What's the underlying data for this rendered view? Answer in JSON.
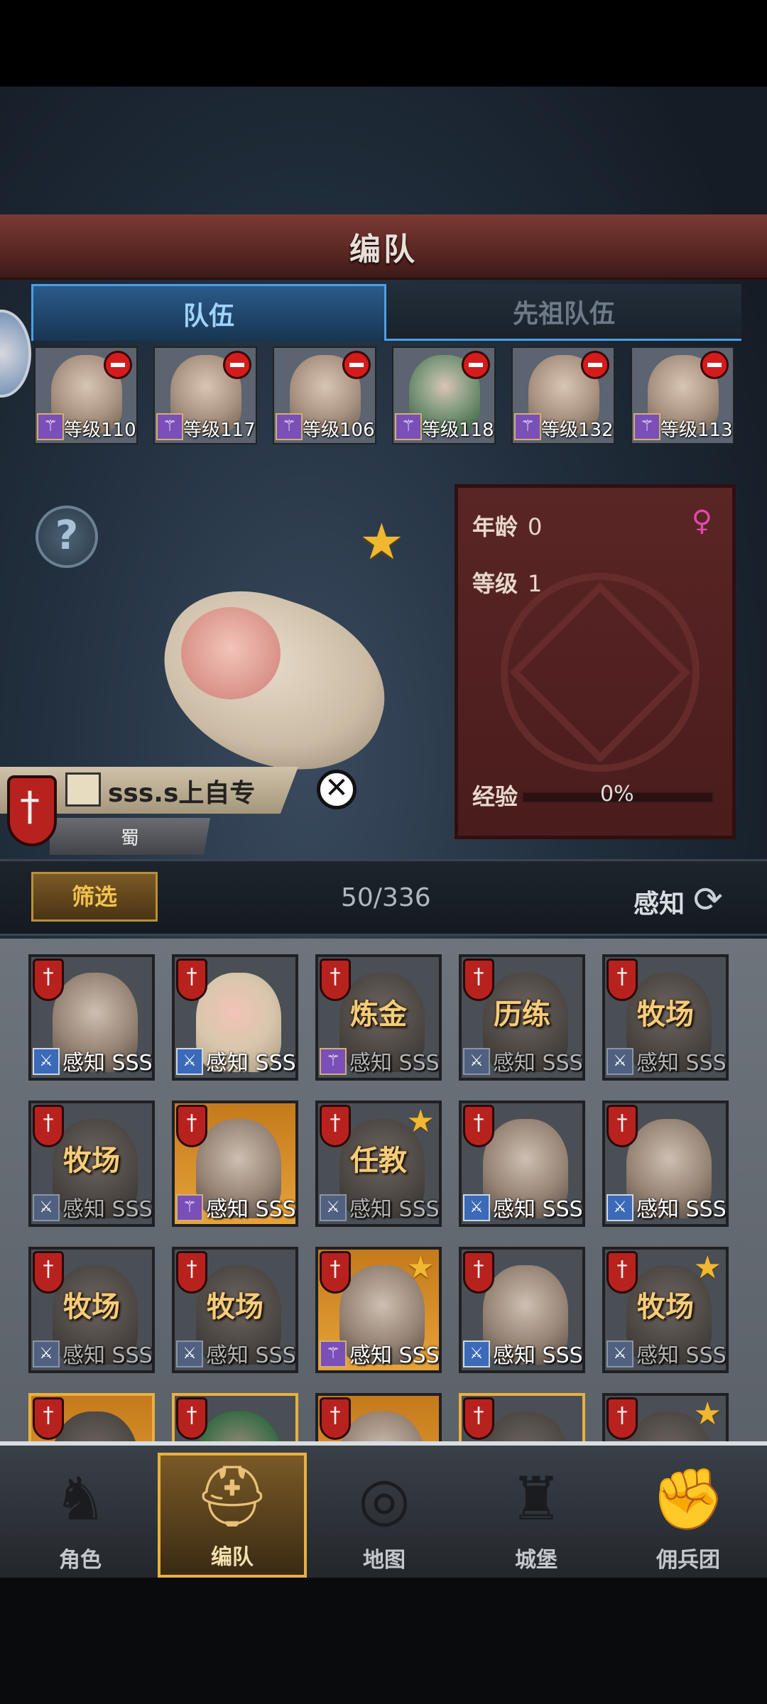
{
  "title": "编队",
  "tabs": {
    "team": "队伍",
    "ancestor_team": "先祖队伍"
  },
  "team_members": [
    {
      "level_text": "等级110"
    },
    {
      "level_text": "等级117"
    },
    {
      "level_text": "等级106"
    },
    {
      "level_text": "等级118"
    },
    {
      "level_text": "等级132"
    },
    {
      "level_text": "等级113"
    }
  ],
  "info": {
    "age_label": "年龄",
    "age_value": "0",
    "level_label": "等级",
    "level_value": "1",
    "exp_label": "经验",
    "exp_value": "0%",
    "exp_progress": 0
  },
  "character": {
    "name": "sss.s上自专",
    "faction": "蜀"
  },
  "filter": {
    "button": "筛选",
    "count": "50/336",
    "sort_label": "感知"
  },
  "grid": {
    "cards": [
      {
        "job": "",
        "stat": "感知 SSS"
      },
      {
        "job": "",
        "stat": "感知 SSS"
      },
      {
        "job": "炼金",
        "stat": "感知 SSS"
      },
      {
        "job": "历练",
        "stat": "感知 SSS"
      },
      {
        "job": "牧场",
        "stat": "感知 SSS"
      },
      {
        "job": "牧场",
        "stat": "感知 SSS"
      },
      {
        "job": "",
        "stat": "感知 SSS"
      },
      {
        "job": "任教",
        "stat": "感知 SSS"
      },
      {
        "job": "",
        "stat": "感知 SSS"
      },
      {
        "job": "",
        "stat": "感知 SSS"
      },
      {
        "job": "牧场",
        "stat": "感知 SSS"
      },
      {
        "job": "牧场",
        "stat": "感知 SSS"
      },
      {
        "job": "",
        "stat": "感知 SSS"
      },
      {
        "job": "",
        "stat": "感知 SSS"
      },
      {
        "job": "牧场",
        "stat": "感知 SSS"
      }
    ]
  },
  "nav": {
    "character": "角色",
    "formation": "编队",
    "map": "地图",
    "castle": "城堡",
    "mercenary": "佣兵团"
  },
  "colors": {
    "accent_blue": "#4aa0e8",
    "gold": "#f0b830",
    "banner_red": "#7a3a34"
  },
  "icons": [
    "question-icon",
    "star-icon",
    "female-gender-icon",
    "pen-icon",
    "close-icon",
    "refresh-icon",
    "shield-sword-icon",
    "remove-icon",
    "knight-icon",
    "helmet-icon",
    "compass-icon",
    "castle-icon",
    "fist-icon"
  ]
}
